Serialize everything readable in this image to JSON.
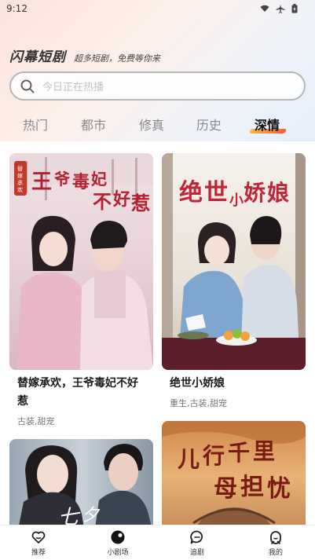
{
  "status": {
    "time": "9:12"
  },
  "brand": {
    "logo": "闪幕短剧",
    "slogan": "超多短剧，免费等你来"
  },
  "search": {
    "placeholder": "今日正在热播"
  },
  "tabs": [
    {
      "label": "热门"
    },
    {
      "label": "都市"
    },
    {
      "label": "修真"
    },
    {
      "label": "历史"
    },
    {
      "label": "深情",
      "active": true
    }
  ],
  "cards": [
    {
      "title": "替嫁承欢，王爷毒妃不好惹",
      "tags": "古装,甜宠",
      "poster_text": "王爷毒妃不好惹",
      "badge": "替嫁承欢"
    },
    {
      "title": "绝世小娇娘",
      "tags": "重生,古装,甜宠",
      "poster_text": "绝世小娇娘"
    },
    {
      "poster_text": "七夕"
    },
    {
      "poster_text": "儿行千里母担忧"
    }
  ],
  "nav": [
    {
      "label": "推荐",
      "icon": "heart-icon"
    },
    {
      "label": "小剧场",
      "icon": "theater-icon"
    },
    {
      "label": "追剧",
      "icon": "chat-icon"
    },
    {
      "label": "我的",
      "icon": "profile-icon"
    }
  ],
  "colors": {
    "accent_gradient_start": "#f8b84a",
    "accent_gradient_end": "#f25d3a"
  }
}
